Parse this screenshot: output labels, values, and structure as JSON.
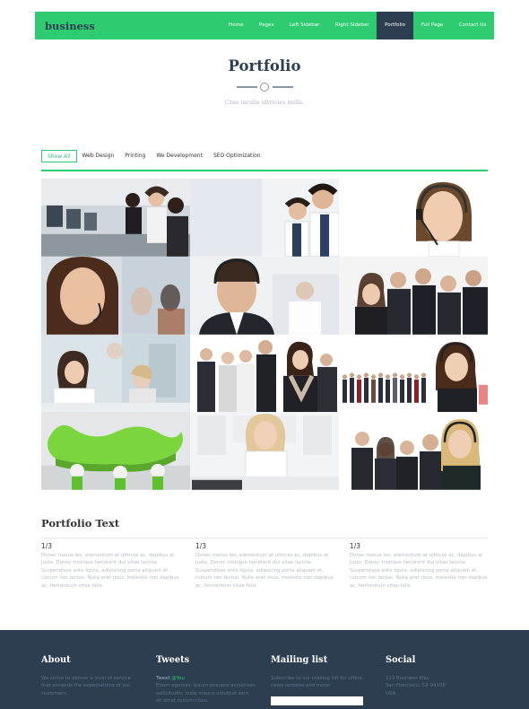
{
  "navbar": {
    "brand": "business",
    "items": [
      {
        "label": "Home"
      },
      {
        "label": "Pages"
      },
      {
        "label": "Left Sidebar"
      },
      {
        "label": "Right Sidebar"
      },
      {
        "label": "Portfolio",
        "active": true
      },
      {
        "label": "Full Page"
      },
      {
        "label": "Contact Us"
      }
    ]
  },
  "header": {
    "title": "Portfolio",
    "subtitle": "Cras iaculis ultricies nulla."
  },
  "filters": [
    {
      "label": "Show All",
      "active": true
    },
    {
      "label": "Web Design"
    },
    {
      "label": "Printing"
    },
    {
      "label": "We Development"
    },
    {
      "label": "SEO Optimization"
    }
  ],
  "portfolio_text": {
    "title": "Portfolio Text",
    "columns": [
      {
        "heading": "1/3",
        "body": "Donec metus leo, elementum at ultrices ac, dapibus at justo. Donec tristique hendrerit dui vitae lacinia. Suspendisse ante ligula, adipiscing porta aliquam et, rutrum nec lectus. Nulla erat risus, molestie non dapibus ac, fermentum vitae felis"
      },
      {
        "heading": "1/3",
        "body": "Donec metus leo, elementum at ultrices ac, dapibus at justo. Donec tristique hendrerit dui vitae lacinia. Suspendisse ante ligula, adipiscing porta aliquam et, rutrum nec lectus. Nulla erat risus, molestie non dapibus ac, fermentum vitae felis"
      },
      {
        "heading": "1/3",
        "body": "Donec metus leo, elementum at ultrices ac, dapibus at justo. Donec tristique hendrerit dui vitae lacinia. Suspendisse ante ligula, adipiscing porta aliquam et, rutrum nec lectus. Nulla erat risus, molestie non dapibus ac, fermentum vitae felis"
      }
    ]
  },
  "footer": {
    "about": {
      "title": "About",
      "text": "We strive to deliver a level of service that exceeds the expectations of our customers."
    },
    "tweets": {
      "title": "Tweets",
      "lead": "Tweet",
      "handle": "@You",
      "text": "Etiam egestas, ipsum posuere accumsan sollicitudin, nulla mauris volutpat sem, sit amet rutrum risus."
    },
    "mailing": {
      "title": "Mailing list",
      "text": "Subscribe to our mailing list for offers, news updates and more!"
    },
    "social": {
      "title": "Social",
      "line1": "123 Business Way",
      "line2": "San Francisco, CA 94108",
      "line3": "USA"
    }
  },
  "colors": {
    "accent": "#2ecc71",
    "dark": "#2c3e50",
    "muted_text": "#b6bcc1"
  }
}
